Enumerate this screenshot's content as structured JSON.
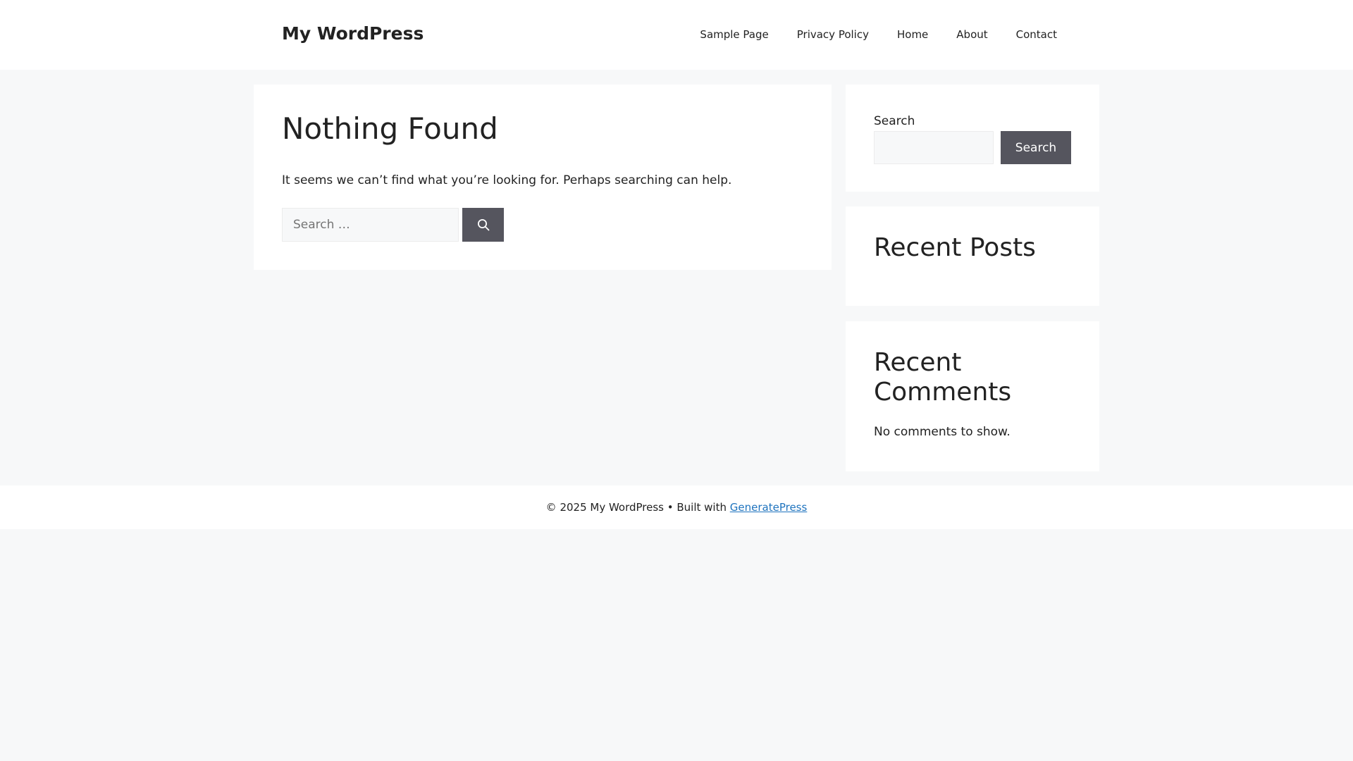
{
  "header": {
    "site_title": "My WordPress",
    "nav": [
      "Sample Page",
      "Privacy Policy",
      "Home",
      "About",
      "Contact"
    ]
  },
  "main": {
    "title": "Nothing Found",
    "message": "It seems we can’t find what you’re looking for. Perhaps searching can help.",
    "search_placeholder": "Search …",
    "search_icon": "search-icon"
  },
  "sidebar": {
    "search_widget": {
      "label": "Search",
      "input_value": "",
      "button_label": "Search"
    },
    "recent_posts": {
      "title": "Recent Posts"
    },
    "recent_comments": {
      "title": "Recent Comments",
      "empty_text": "No comments to show."
    }
  },
  "footer": {
    "prefix": "© 2025 My WordPress • Built with ",
    "link_text": "GeneratePress"
  },
  "colors": {
    "page_background": "#f7f8f9",
    "button_background": "#55555e",
    "link": "#1e73be",
    "text": "#222222"
  }
}
